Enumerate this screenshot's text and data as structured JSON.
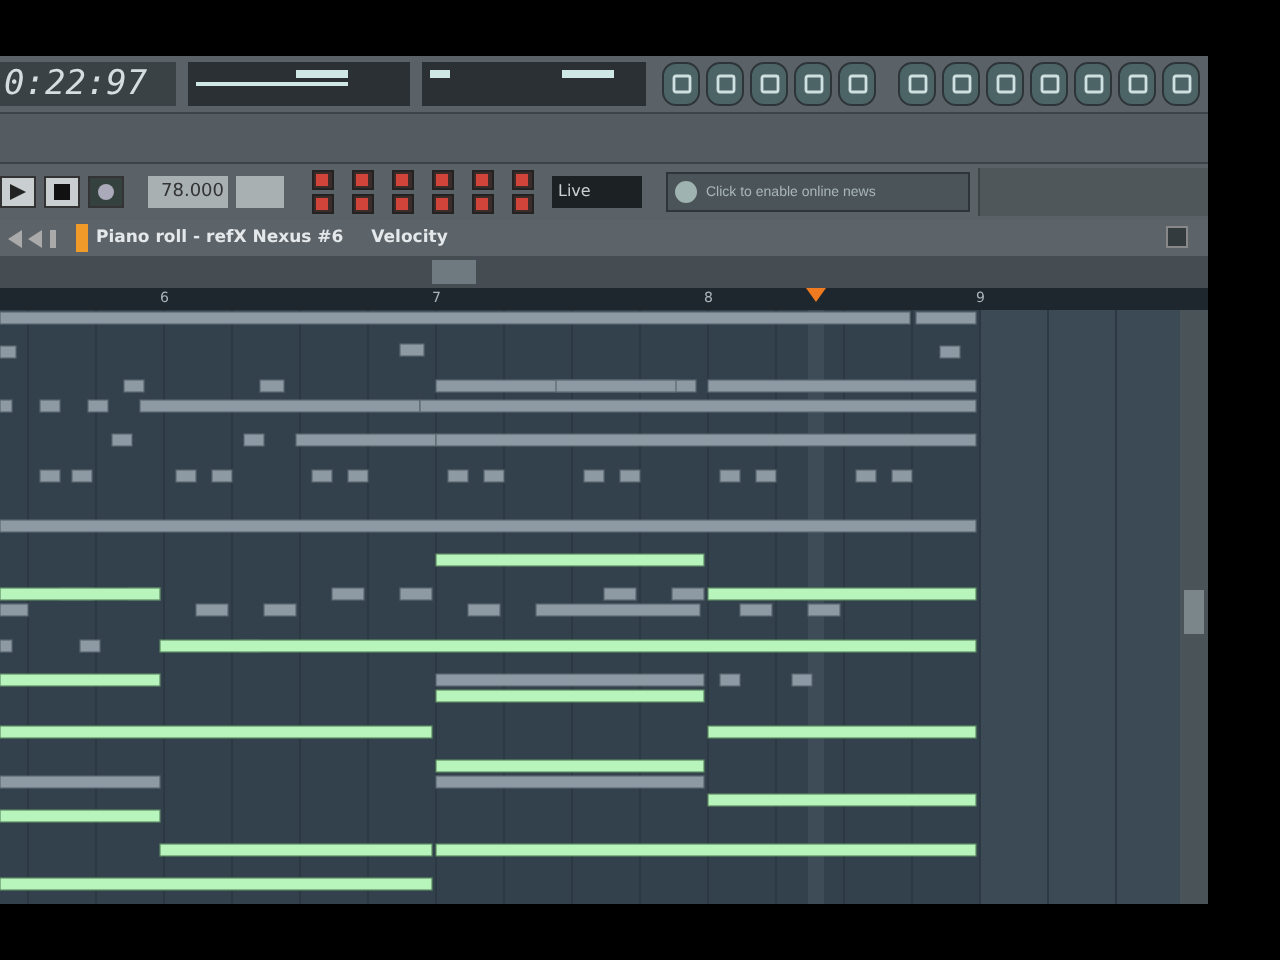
{
  "toolbar": {
    "time": "0:22:97",
    "tempo": "78.000",
    "live_label": "Live",
    "news": "Click to enable online news"
  },
  "piano_roll": {
    "title": "Piano roll - refX Nexus #6",
    "target": "Velocity",
    "bars": [
      "6",
      "7",
      "8",
      "9"
    ]
  }
}
